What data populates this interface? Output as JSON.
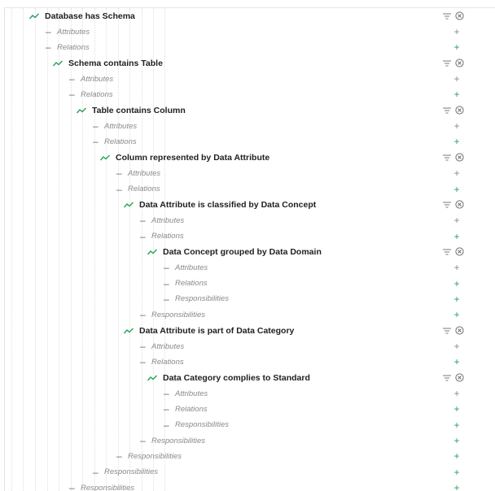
{
  "rows": [
    {
      "type": "relation",
      "label": "Database has Schema",
      "level": 0
    },
    {
      "type": "section",
      "label": "Attributes",
      "level": 0,
      "add_active": false
    },
    {
      "type": "section",
      "label": "Relations",
      "level": 0,
      "add_active": true
    },
    {
      "type": "relation",
      "label": "Schema contains Table",
      "level": 1
    },
    {
      "type": "section",
      "label": "Attributes",
      "level": 1,
      "add_active": false
    },
    {
      "type": "section",
      "label": "Relations",
      "level": 1,
      "add_active": true
    },
    {
      "type": "relation",
      "label": "Table contains Column",
      "level": 2
    },
    {
      "type": "section",
      "label": "Attributes",
      "level": 2,
      "add_active": false
    },
    {
      "type": "section",
      "label": "Relations",
      "level": 2,
      "add_active": true
    },
    {
      "type": "relation",
      "label": "Column represented by Data Attribute",
      "level": 3
    },
    {
      "type": "section",
      "label": "Attributes",
      "level": 3,
      "add_active": false
    },
    {
      "type": "section",
      "label": "Relations",
      "level": 3,
      "add_active": true
    },
    {
      "type": "relation",
      "label": "Data Attribute is classified by Data Concept",
      "level": 4
    },
    {
      "type": "section",
      "label": "Attributes",
      "level": 4,
      "add_active": false
    },
    {
      "type": "section",
      "label": "Relations",
      "level": 4,
      "add_active": true
    },
    {
      "type": "relation",
      "label": "Data Concept grouped by Data Domain",
      "level": 5
    },
    {
      "type": "section",
      "label": "Attributes",
      "level": 5,
      "add_active": false
    },
    {
      "type": "section",
      "label": "Relations",
      "level": 5,
      "add_active": true
    },
    {
      "type": "section",
      "label": "Responsibilities",
      "level": 5,
      "add_active": true
    },
    {
      "type": "section",
      "label": "Responsibilities",
      "level": 4,
      "add_active": true
    },
    {
      "type": "relation",
      "label": "Data Attribute is part of Data Category",
      "level": 4
    },
    {
      "type": "section",
      "label": "Attributes",
      "level": 4,
      "add_active": false
    },
    {
      "type": "section",
      "label": "Relations",
      "level": 4,
      "add_active": true
    },
    {
      "type": "relation",
      "label": "Data Category complies to Standard",
      "level": 5
    },
    {
      "type": "section",
      "label": "Attributes",
      "level": 5,
      "add_active": false
    },
    {
      "type": "section",
      "label": "Relations",
      "level": 5,
      "add_active": true
    },
    {
      "type": "section",
      "label": "Responsibilities",
      "level": 5,
      "add_active": true
    },
    {
      "type": "section",
      "label": "Responsibilities",
      "level": 4,
      "add_active": true
    },
    {
      "type": "section",
      "label": "Responsibilities",
      "level": 3,
      "add_active": true
    },
    {
      "type": "section",
      "label": "Responsibilities",
      "level": 2,
      "add_active": true
    },
    {
      "type": "section",
      "label": "Responsibilities",
      "level": 1,
      "add_active": true
    }
  ],
  "icons": {
    "relation_icon": "trend-line-icon",
    "section_icon": "dash-icon",
    "add_icon": "plus-icon",
    "filter_icon": "filter-icon",
    "remove_icon": "close-circle-icon"
  },
  "add_symbol": "+",
  "dash_symbol": "–",
  "colors": {
    "accent_green": "#2aa15a",
    "muted_text": "#8a8a8a",
    "title_text": "#1f1f1f"
  }
}
